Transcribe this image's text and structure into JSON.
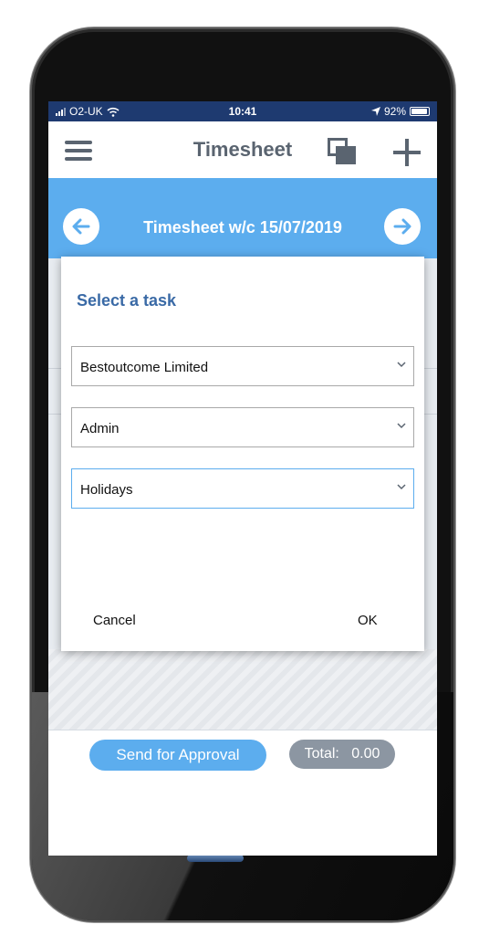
{
  "status_bar": {
    "carrier": "O2-UK",
    "time": "10:41",
    "battery": "92%",
    "battery_level": 0.92
  },
  "header": {
    "title": "Timesheet"
  },
  "week": {
    "title": "Timesheet w/c 15/07/2019"
  },
  "dialog": {
    "title": "Select a task",
    "selects": [
      {
        "value": "Bestoutcome Limited"
      },
      {
        "value": "Admin"
      },
      {
        "value": "Holidays"
      }
    ],
    "cancel_label": "Cancel",
    "ok_label": "OK"
  },
  "footer": {
    "send_label": "Send for Approval",
    "total_label": "Total:",
    "total_value": "0.00"
  },
  "colors": {
    "accent": "#5cadee",
    "title_blue": "#3a6aa6",
    "status_bar": "#1e3a70",
    "pill_gray": "#8c96a2"
  }
}
